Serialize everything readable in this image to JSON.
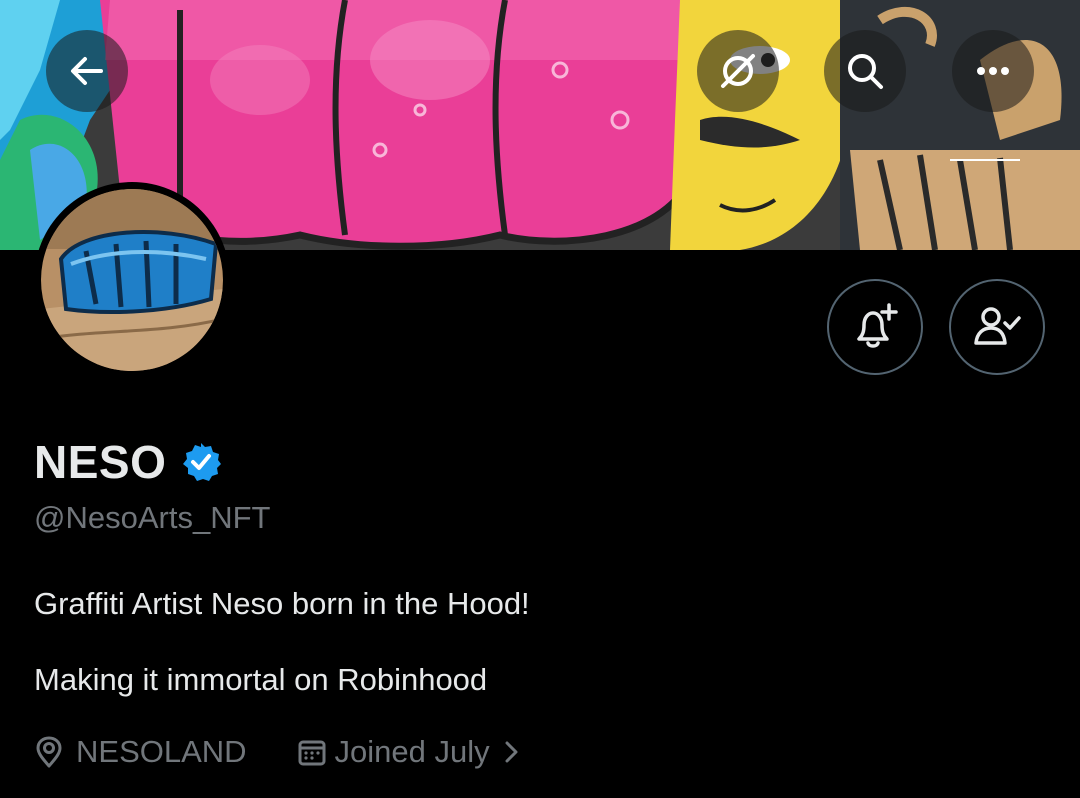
{
  "header": {
    "back_icon": "arrow-left-icon",
    "grok_icon": "grok-icon",
    "search_icon": "search-icon",
    "more_icon": "more-horizontal-icon"
  },
  "profile": {
    "display_name": "NESO",
    "verified": true,
    "handle": "@NesoArts_NFT",
    "bio_line_1": "Graffiti Artist Neso born in the Hood!",
    "bio_line_2": "Making it immortal on Robinhood",
    "location": "NESOLAND",
    "joined": "Joined July"
  },
  "actions": {
    "notify_icon": "bell-plus-icon",
    "following_icon": "user-check-icon"
  },
  "colors": {
    "background": "#000000",
    "text_primary": "#e7e9ea",
    "text_secondary": "#71767b",
    "border": "#536471",
    "verified_blue": "#1d9bf0"
  }
}
